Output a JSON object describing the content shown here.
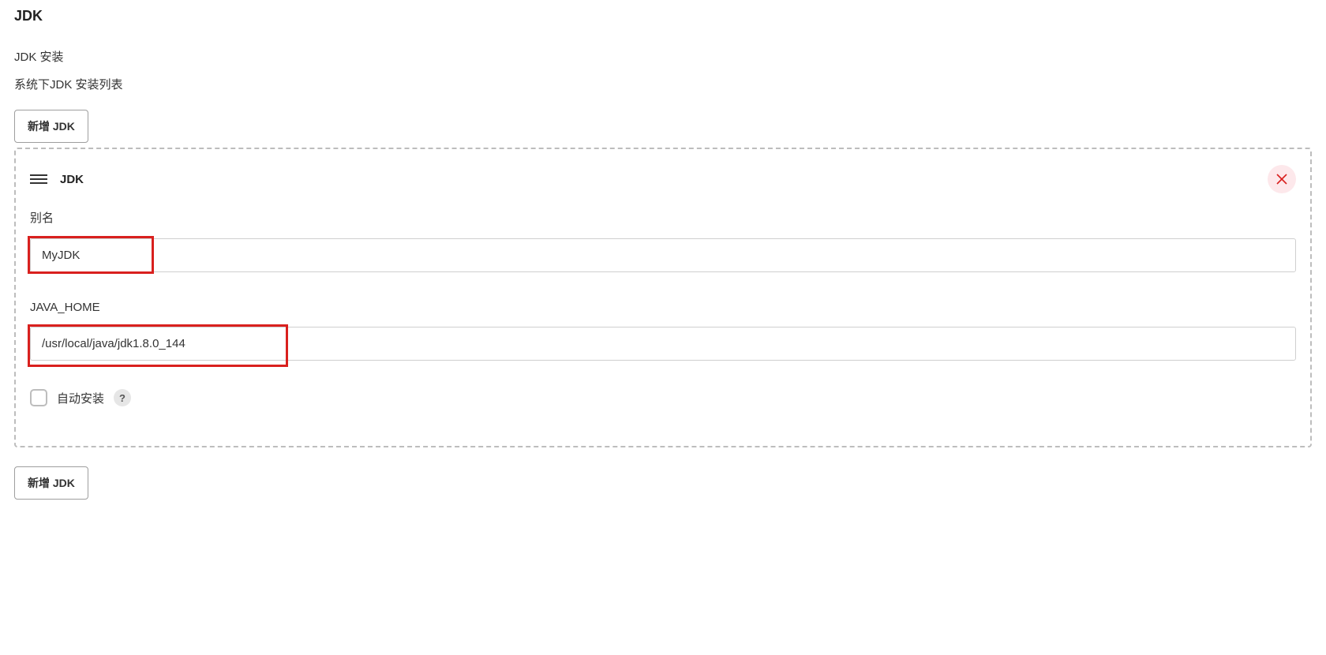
{
  "page": {
    "title": "JDK"
  },
  "section": {
    "subtitle": "JDK 安装",
    "description": "系统下JDK 安装列表"
  },
  "buttons": {
    "add_jdk_top": "新增 JDK",
    "add_jdk_bottom": "新增 JDK"
  },
  "installation": {
    "header_title": "JDK",
    "fields": {
      "alias": {
        "label": "别名",
        "value": "MyJDK"
      },
      "java_home": {
        "label": "JAVA_HOME",
        "value": "/usr/local/java/jdk1.8.0_144"
      },
      "auto_install": {
        "label": "自动安装",
        "checked": false,
        "help": "?"
      }
    }
  }
}
